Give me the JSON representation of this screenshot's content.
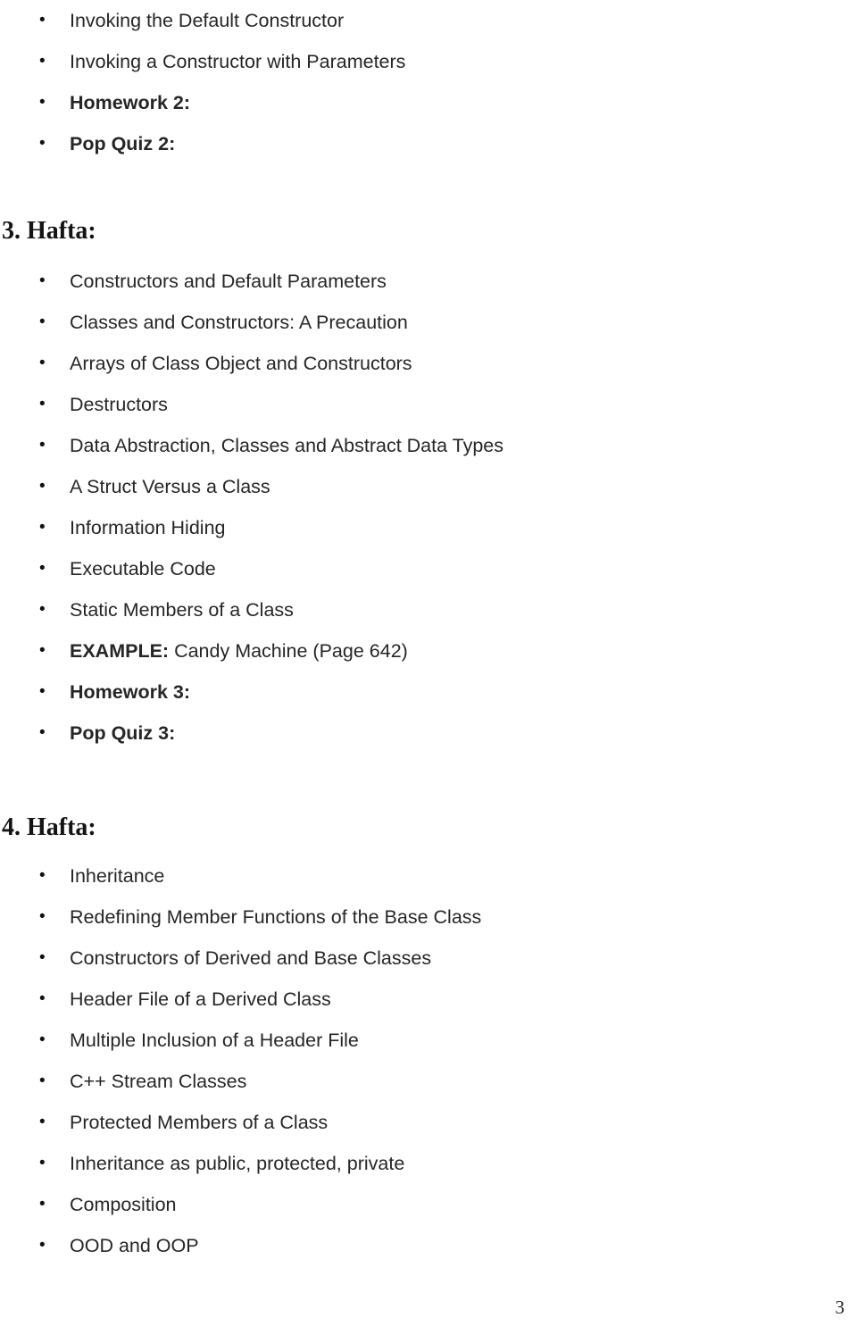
{
  "document": {
    "page_number": "3",
    "bullet_glyph": "•"
  },
  "sections": [
    {
      "heading": null,
      "items": [
        {
          "text": "Invoking the Default Constructor",
          "bold": false
        },
        {
          "text": "Invoking a Constructor with Parameters",
          "bold": false
        },
        {
          "text": "Homework 2:",
          "bold": true
        },
        {
          "text": "Pop Quiz 2:",
          "bold": true
        }
      ]
    },
    {
      "heading": "3. Hafta:",
      "items": [
        {
          "text": "Constructors and Default Parameters",
          "bold": false
        },
        {
          "text": "Classes and Constructors: A Precaution",
          "bold": false
        },
        {
          "text": "Arrays of Class Object and Constructors",
          "bold": false
        },
        {
          "text": "Destructors",
          "bold": false
        },
        {
          "text": "Data Abstraction, Classes and Abstract Data Types",
          "bold": false
        },
        {
          "text": "A Struct Versus a Class",
          "bold": false
        },
        {
          "text": "Information Hiding",
          "bold": false
        },
        {
          "text": "Executable Code",
          "bold": false
        },
        {
          "text": "Static Members of a Class",
          "bold": false
        },
        {
          "lead": "EXAMPLE:",
          "text": " Candy Machine (Page 642)",
          "bold": false
        },
        {
          "text": "Homework 3:",
          "bold": true
        },
        {
          "text": "Pop Quiz 3:",
          "bold": true
        }
      ]
    },
    {
      "heading": "4. Hafta:",
      "items": [
        {
          "text": "Inheritance",
          "bold": false
        },
        {
          "text": "Redefining Member Functions of the Base Class",
          "bold": false
        },
        {
          "text": "Constructors of Derived and Base Classes",
          "bold": false
        },
        {
          "text": "Header File of a Derived Class",
          "bold": false
        },
        {
          "text": "Multiple Inclusion of a Header File",
          "bold": false
        },
        {
          "text": "C++ Stream Classes",
          "bold": false
        },
        {
          "text": "Protected Members of a Class",
          "bold": false
        },
        {
          "text": "Inheritance as public, protected, private",
          "bold": false
        },
        {
          "text": "Composition",
          "bold": false
        },
        {
          "text": "OOD and OOP",
          "bold": false
        }
      ]
    }
  ]
}
